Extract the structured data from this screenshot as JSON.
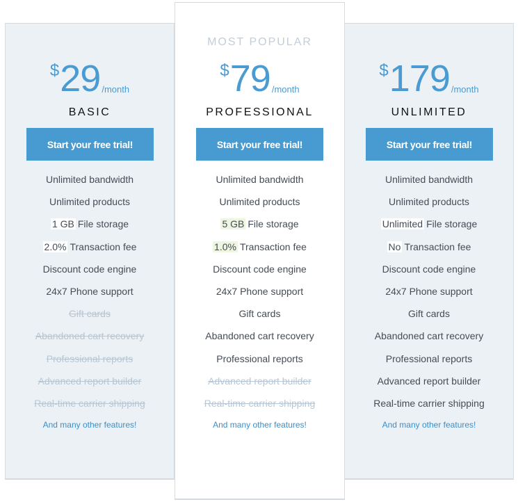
{
  "colors": {
    "accent": "#489bd0",
    "side_card_bg": "#ecf1f5",
    "featured_card_bg": "#ffffff",
    "disabled_text": "#b7c6d2",
    "featured_highlight": "#eef6e1"
  },
  "plans": [
    {
      "currency": "$",
      "amount": "29",
      "period": "/month",
      "name": "BASIC",
      "cta": "Start your free trial!",
      "features": [
        {
          "label": "Unlimited bandwidth",
          "enabled": true
        },
        {
          "label": "Unlimited products",
          "enabled": true
        },
        {
          "highlight": "1 GB",
          "label": "File storage",
          "enabled": true
        },
        {
          "highlight": "2.0%",
          "label": "Transaction fee",
          "enabled": true
        },
        {
          "label": "Discount code engine",
          "enabled": true
        },
        {
          "label": "24x7 Phone support",
          "enabled": true
        },
        {
          "label": "Gift cards",
          "enabled": false
        },
        {
          "label": "Abandoned cart recovery",
          "enabled": false
        },
        {
          "label": "Professional reports",
          "enabled": false
        },
        {
          "label": "Advanced report builder",
          "enabled": false
        },
        {
          "label": "Real-time carrier shipping",
          "enabled": false
        }
      ],
      "more": "And many other features!"
    },
    {
      "badge": "MOST POPULAR",
      "currency": "$",
      "amount": "79",
      "period": "/month",
      "name": "PROFESSIONAL",
      "cta": "Start your free trial!",
      "features": [
        {
          "label": "Unlimited bandwidth",
          "enabled": true
        },
        {
          "label": "Unlimited products",
          "enabled": true
        },
        {
          "highlight": "5 GB",
          "label": "File storage",
          "enabled": true
        },
        {
          "highlight": "1.0%",
          "label": "Transaction fee",
          "enabled": true
        },
        {
          "label": "Discount code engine",
          "enabled": true
        },
        {
          "label": "24x7 Phone support",
          "enabled": true
        },
        {
          "label": "Gift cards",
          "enabled": true
        },
        {
          "label": "Abandoned cart recovery",
          "enabled": true
        },
        {
          "label": "Professional reports",
          "enabled": true
        },
        {
          "label": "Advanced report builder",
          "enabled": false
        },
        {
          "label": "Real-time carrier shipping",
          "enabled": false
        }
      ],
      "more": "And many other features!"
    },
    {
      "currency": "$",
      "amount": "179",
      "period": "/month",
      "name": "UNLIMITED",
      "cta": "Start your free trial!",
      "features": [
        {
          "label": "Unlimited bandwidth",
          "enabled": true
        },
        {
          "label": "Unlimited products",
          "enabled": true
        },
        {
          "highlight": "Unlimited",
          "label": "File storage",
          "enabled": true
        },
        {
          "highlight": "No",
          "label": "Transaction fee",
          "enabled": true
        },
        {
          "label": "Discount code engine",
          "enabled": true
        },
        {
          "label": "24x7 Phone support",
          "enabled": true
        },
        {
          "label": "Gift cards",
          "enabled": true
        },
        {
          "label": "Abandoned cart recovery",
          "enabled": true
        },
        {
          "label": "Professional reports",
          "enabled": true
        },
        {
          "label": "Advanced report builder",
          "enabled": true
        },
        {
          "label": "Real-time carrier shipping",
          "enabled": true
        }
      ],
      "more": "And many other features!"
    }
  ]
}
